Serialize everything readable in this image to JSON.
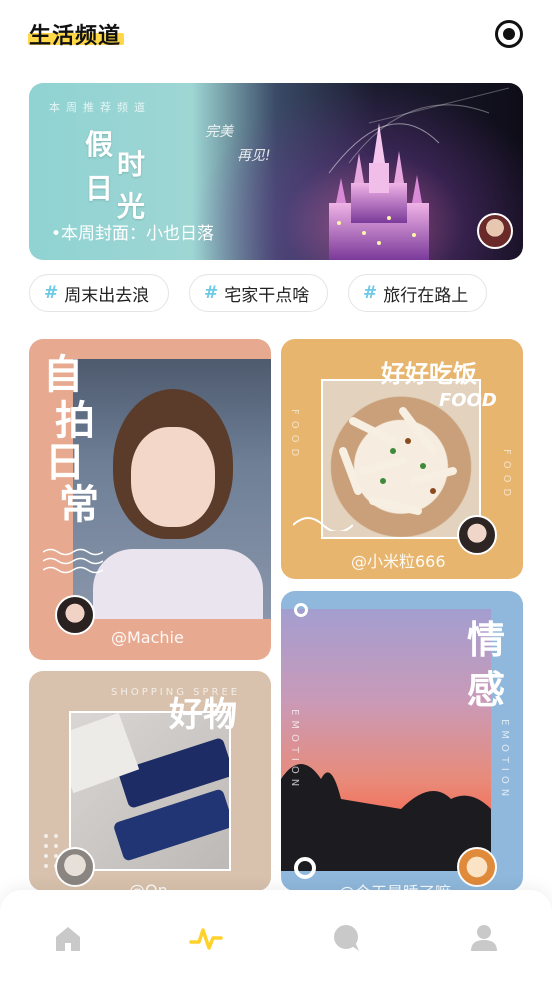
{
  "header": {
    "title": "生活频道",
    "record_icon": "record-icon"
  },
  "banner": {
    "label": "本周推荐频道",
    "headline_1": "假",
    "headline_2": "时",
    "headline_3": "日",
    "headline_4": "光",
    "script_1": "完美",
    "script_2": "再见!",
    "cover_text": "•本周封面：小也日落"
  },
  "tags": [
    {
      "label": "周末出去浪"
    },
    {
      "label": "宅家干点啥"
    },
    {
      "label": "旅行在路上"
    }
  ],
  "cards": {
    "selfie": {
      "title_1": "自",
      "title_2": "拍",
      "title_3": "日",
      "title_4": "常",
      "handle": "@Machie"
    },
    "food": {
      "title": "好好吃饭",
      "subtitle": "FOOD",
      "side_text": "FOOD",
      "handle": "@小米粒666"
    },
    "emotion": {
      "title_1": "情",
      "title_2": "感",
      "side_text_left": "EMOTION",
      "side_text_right": "EMOTION",
      "handle": "@今天是睡了嘛"
    },
    "goods": {
      "title": "好物",
      "subtitle": "SHOPPING SPREE",
      "handle": "@Qn"
    }
  },
  "nav": {
    "items": [
      {
        "icon": "home-icon"
      },
      {
        "icon": "pulse-icon",
        "active_color": "#ffd22b"
      },
      {
        "icon": "chat-icon"
      },
      {
        "icon": "profile-icon"
      }
    ]
  }
}
